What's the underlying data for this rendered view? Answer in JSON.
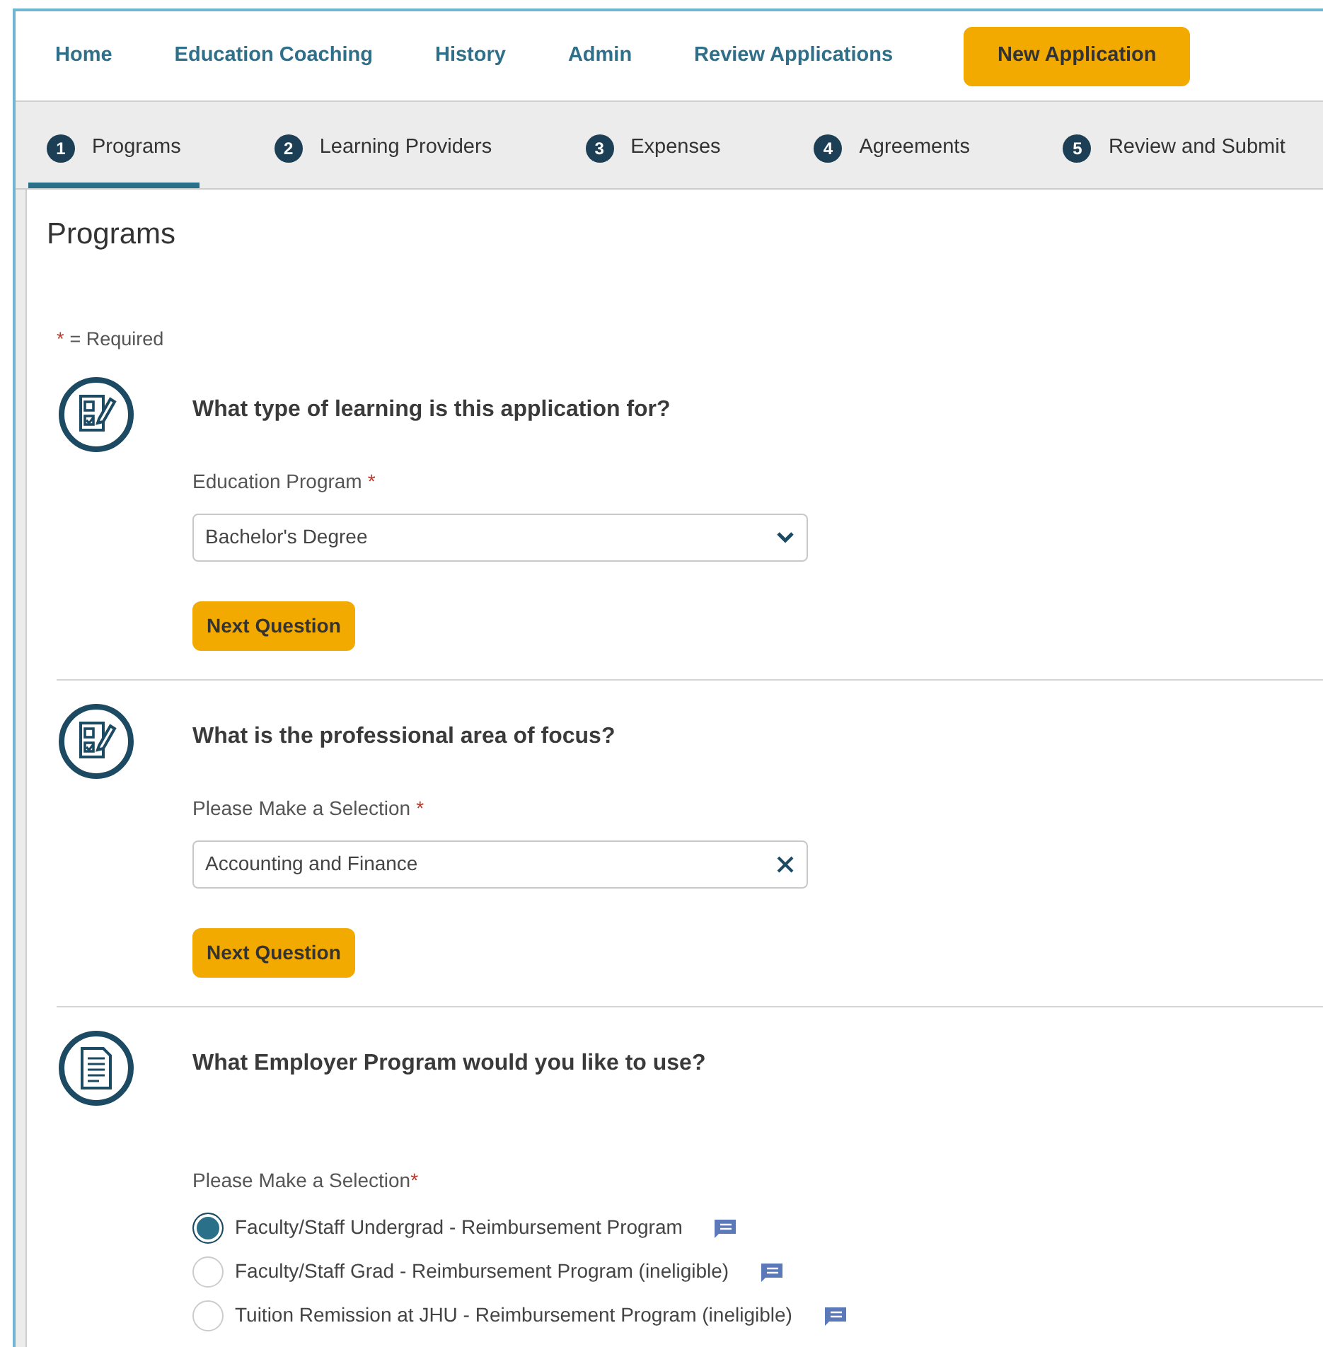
{
  "nav": {
    "links": [
      "Home",
      "Education Coaching",
      "History",
      "Admin",
      "Review Applications"
    ],
    "cta": "New Application"
  },
  "steps": [
    {
      "number": "1",
      "label": "Programs",
      "selected": true
    },
    {
      "number": "2",
      "label": "Learning Providers",
      "selected": false
    },
    {
      "number": "3",
      "label": "Expenses",
      "selected": false
    },
    {
      "number": "4",
      "label": "Agreements",
      "selected": false
    },
    {
      "number": "5",
      "label": "Review and Submit",
      "selected": false
    }
  ],
  "page_title": "Programs",
  "required_note": {
    "mark": "*",
    "text": "= Required"
  },
  "questions": [
    {
      "kind": "select",
      "question": "What type of learning is this application for?",
      "label": "Education Program",
      "mark": "*",
      "value": "Bachelor's Degree",
      "button": "Next Question"
    },
    {
      "kind": "combobox",
      "question": "What is the professional area of focus?",
      "label": "Please Make a Selection",
      "mark": "*",
      "value": "Accounting and Finance",
      "button": "Next Question"
    },
    {
      "kind": "radio",
      "question": "What Employer Program would you like to use?",
      "label": "Please Make a Selection",
      "mark": "*",
      "options": [
        {
          "label": "Faculty/Staff Undergrad - Reimbursement Program",
          "selected": true
        },
        {
          "label": "Faculty/Staff Grad - Reimbursement Program (ineligible)",
          "selected": false
        },
        {
          "label": "Tuition Remission at JHU - Reimbursement Program (ineligible)",
          "selected": false
        }
      ]
    }
  ]
}
